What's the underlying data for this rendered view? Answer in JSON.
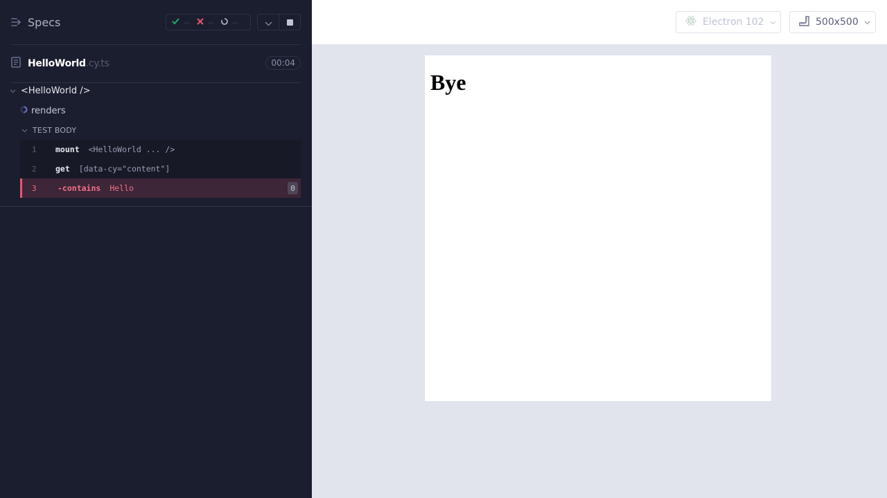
{
  "reporter": {
    "specs_label": "Specs",
    "stats": {
      "passed": "--",
      "failed": "--",
      "pending": "--"
    },
    "file": {
      "name": "HelloWorld",
      "ext": ".cy.ts",
      "duration": "00:04"
    },
    "suite": {
      "title": "<HelloWorld />"
    },
    "test": {
      "title": "renders",
      "section": "TEST BODY"
    },
    "commands": [
      {
        "num": "1",
        "name": "mount",
        "message": "<HelloWorld ... />",
        "state": "passed"
      },
      {
        "num": "2",
        "name": "get",
        "message": "[data-cy=\"content\"]",
        "state": "passed"
      },
      {
        "num": "3",
        "name": "-contains",
        "message": "Hello",
        "state": "failed",
        "count": "0"
      }
    ]
  },
  "topbar": {
    "browser": "Electron 102",
    "viewport": "500x500"
  },
  "aut": {
    "heading": "Bye"
  },
  "colors": {
    "pass": "#1fa971",
    "fail": "#e45770",
    "panel_bg": "#1b1e2e",
    "stage_bg": "#e1e3ed"
  }
}
